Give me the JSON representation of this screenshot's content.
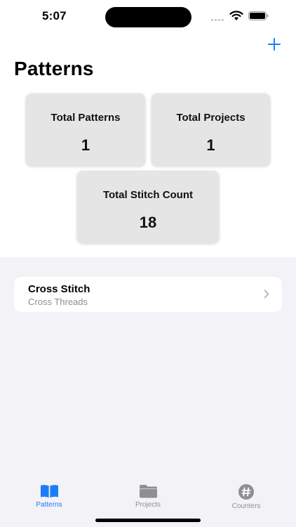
{
  "status_bar": {
    "time": "5:07"
  },
  "header": {
    "title": "Patterns",
    "add_icon": "plus-icon"
  },
  "stats": [
    {
      "label": "Total Patterns",
      "value": "1"
    },
    {
      "label": "Total Projects",
      "value": "1"
    },
    {
      "label": "Total Stitch Count",
      "value": "18"
    }
  ],
  "patterns_list": [
    {
      "title": "Cross Stitch",
      "subtitle": "Cross Threads"
    }
  ],
  "tab_bar": {
    "tabs": [
      {
        "label": "Patterns",
        "icon": "book-icon",
        "selected": true
      },
      {
        "label": "Projects",
        "icon": "folder-icon",
        "selected": false
      },
      {
        "label": "Counters",
        "icon": "hash-icon",
        "selected": false
      }
    ]
  },
  "colors": {
    "accent": "#1c7ef5",
    "tab_inactive": "#8e8e93",
    "background": "#f2f2f7",
    "card": "#e5e5e5"
  }
}
